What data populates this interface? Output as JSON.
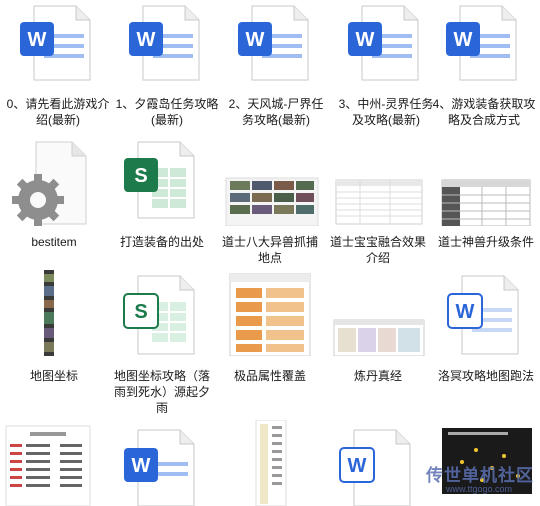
{
  "files": [
    {
      "type": "word",
      "label": "0、请先看此游戏介绍(最新)"
    },
    {
      "type": "word",
      "label": "1、夕霞岛任务攻略(最新)"
    },
    {
      "type": "word",
      "label": "2、天风城-尸界任务攻略(最新)"
    },
    {
      "type": "word",
      "label": "3、中州-灵界任务及攻略(最新)"
    },
    {
      "type": "word",
      "label": "4、游戏装备获取攻略及合成方式"
    },
    {
      "type": "settings",
      "label": "bestitem"
    },
    {
      "type": "sheet",
      "label": "打造装备的出处"
    },
    {
      "type": "image-grid",
      "label": "道士八大异兽抓捕地点"
    },
    {
      "type": "image-table",
      "label": "道士宝宝融合效果介绍"
    },
    {
      "type": "image-table2",
      "label": "道士神兽升级条件"
    },
    {
      "type": "image-strip",
      "label": "地图坐标"
    },
    {
      "type": "sheet-light",
      "label": "地图坐标攻略（落雨到死水）源起夕雨"
    },
    {
      "type": "image-orange",
      "label": "极品属性覆盖"
    },
    {
      "type": "image-wide",
      "label": "炼丹真经"
    },
    {
      "type": "word-light",
      "label": "洛冥攻略地图跑法"
    },
    {
      "type": "image-list",
      "label": ""
    },
    {
      "type": "word",
      "label": ""
    },
    {
      "type": "image-long",
      "label": ""
    },
    {
      "type": "word-light",
      "label": ""
    },
    {
      "type": "image-dark",
      "label": ""
    }
  ],
  "watermark": {
    "text": "传世单机社区",
    "url": "www.ttgogo.com"
  },
  "colors": {
    "word": "#2b66d9",
    "sheet": "#1d7a4a",
    "text": "#1a1a1a"
  }
}
